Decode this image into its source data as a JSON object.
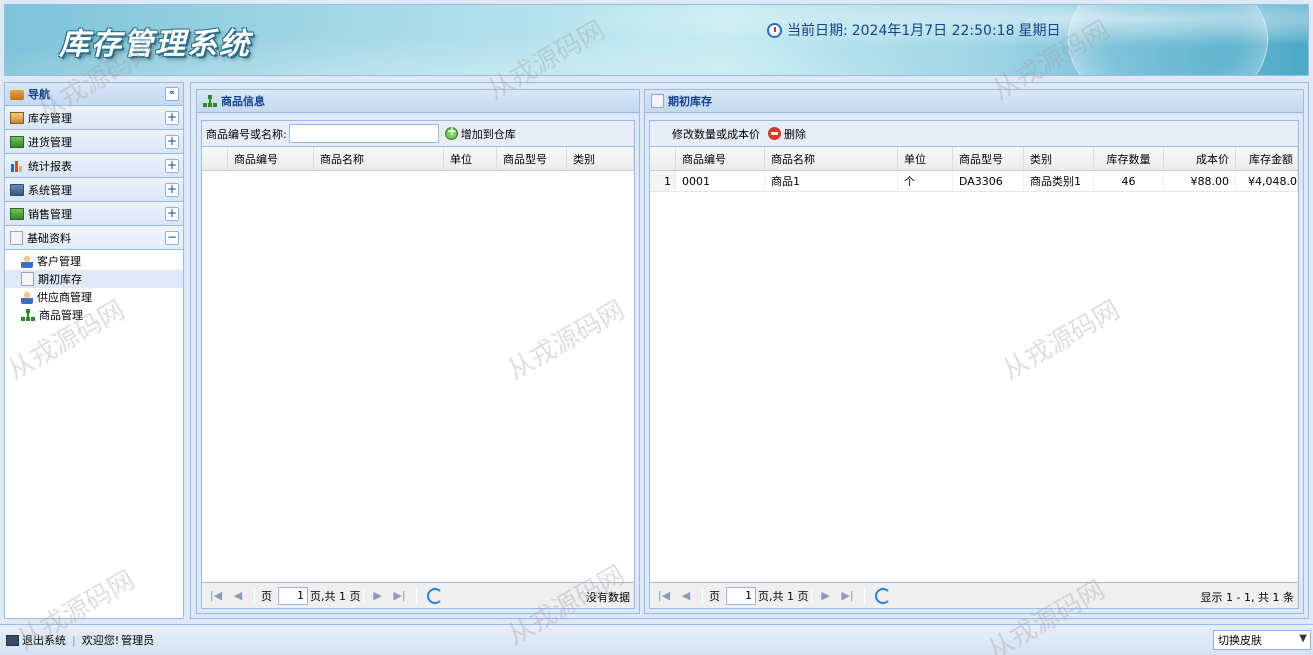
{
  "header": {
    "title": "库存管理系统",
    "date_label": "当前日期:",
    "date_value": "2024年1月7日 22:50:18",
    "weekday": "星期日"
  },
  "sidebar": {
    "title": "导航",
    "collapse": "«",
    "sections": [
      {
        "label": "库存管理",
        "toggle": "+"
      },
      {
        "label": "进货管理",
        "toggle": "+"
      },
      {
        "label": "统计报表",
        "toggle": "+"
      },
      {
        "label": "系统管理",
        "toggle": "+"
      },
      {
        "label": "销售管理",
        "toggle": "+"
      },
      {
        "label": "基础资料",
        "toggle": "−"
      }
    ],
    "sub_items": [
      {
        "label": "客户管理"
      },
      {
        "label": "期初库存"
      },
      {
        "label": "供应商管理"
      },
      {
        "label": "商品管理"
      }
    ]
  },
  "goods_panel": {
    "title": "商品信息",
    "search_label": "商品编号或名称:",
    "search_value": "",
    "add_button": "增加到仓库",
    "columns": [
      "商品编号",
      "商品名称",
      "单位",
      "商品型号",
      "类别"
    ],
    "pager": {
      "page_label": "页",
      "page_value": "1",
      "total_label": "页,共 1 页",
      "info": "没有数据"
    }
  },
  "stock_panel": {
    "title": "期初库存",
    "modify_button": "修改数量或成本价",
    "delete_button": "删除",
    "columns": [
      "商品编号",
      "商品名称",
      "单位",
      "商品型号",
      "类别",
      "库存数量",
      "成本价",
      "库存金额"
    ],
    "rows": [
      {
        "rn": "1",
        "code": "0001",
        "name": "商品1",
        "unit": "个",
        "model": "DA3306",
        "category": "商品类别1",
        "qty": "46",
        "cost": "¥88.00",
        "amount": "¥4,048.0"
      }
    ],
    "pager": {
      "page_label": "页",
      "page_value": "1",
      "total_label": "页,共 1 页",
      "info": "显示 1 - 1, 共 1 条"
    }
  },
  "footer": {
    "exit_label": "退出系统",
    "welcome": "欢迎您!",
    "user": "管理员",
    "skin_label": "切换皮肤"
  },
  "watermark": "从戎源码网"
}
